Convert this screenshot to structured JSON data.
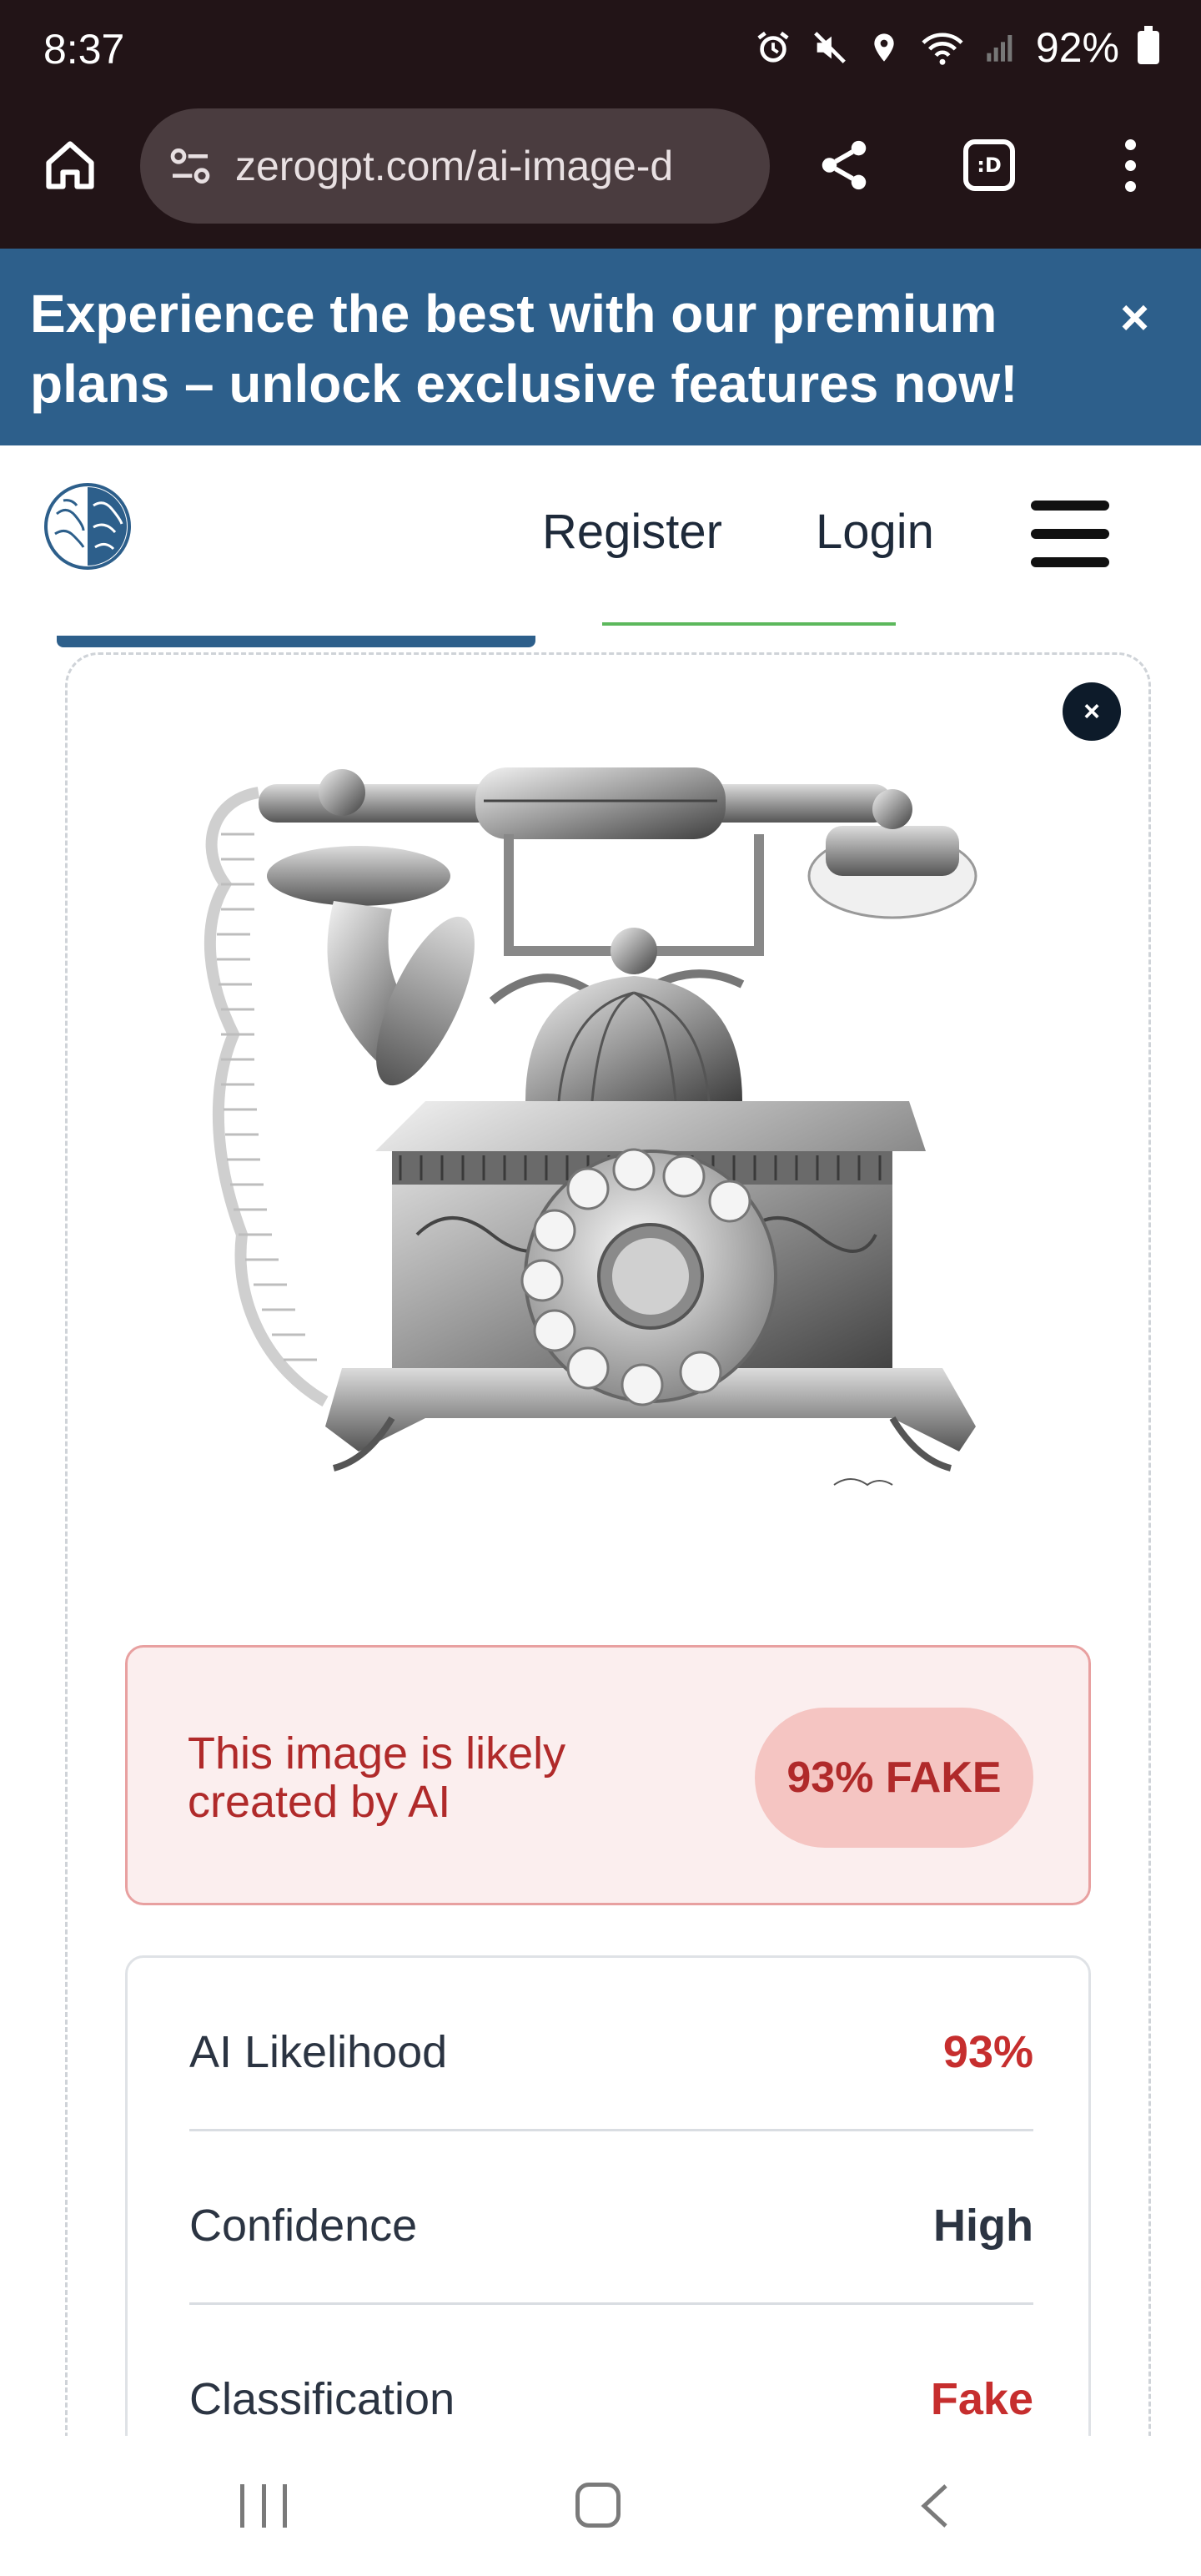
{
  "status_bar": {
    "time": "8:37",
    "battery": "92%"
  },
  "browser": {
    "url": "zerogpt.com/ai-image-d",
    "tabs_label": ":D"
  },
  "promo": {
    "text": "Experience the best with our premium plans – unlock exclusive features now!",
    "close": "×"
  },
  "header": {
    "register": "Register",
    "login": "Login"
  },
  "card": {
    "close": "×"
  },
  "verdict": {
    "text": "This image is likely created by AI",
    "badge": "93% FAKE"
  },
  "metrics": [
    {
      "label": "AI Likelihood",
      "value": "93%"
    },
    {
      "label": "Confidence",
      "value": "High"
    },
    {
      "label": "Classification",
      "value": "Fake"
    }
  ],
  "colors": {
    "primary": "#2d5f8b",
    "danger": "#c62e2e",
    "chrome": "#221417"
  }
}
